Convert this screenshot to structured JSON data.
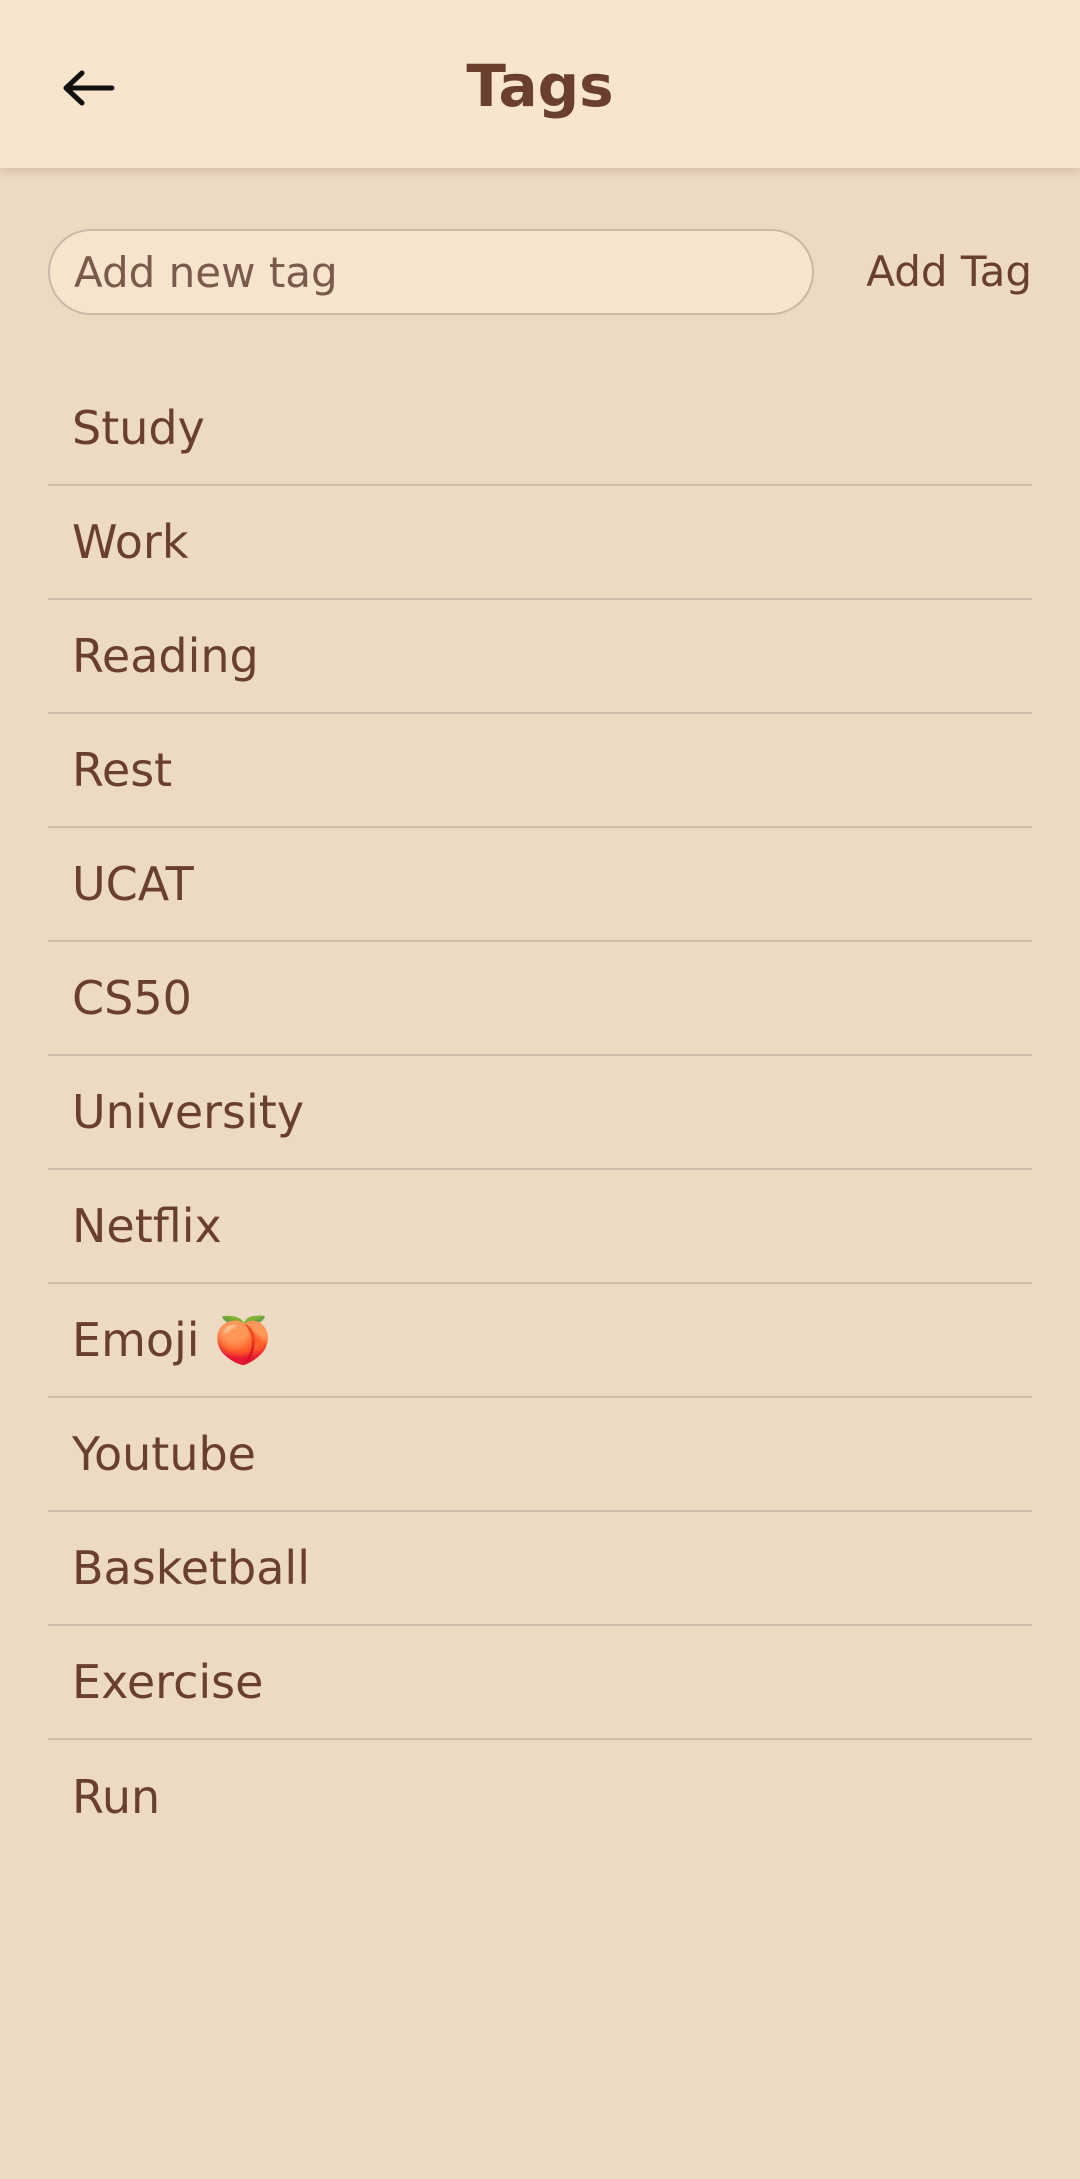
{
  "header": {
    "title": "Tags",
    "back_icon": "arrow-left-icon"
  },
  "add_tag": {
    "placeholder": "Add new tag",
    "value": "",
    "button_label": "Add Tag"
  },
  "tags": [
    "Study",
    "Work",
    "Reading",
    "Rest",
    "UCAT",
    "CS50",
    "University",
    "Netflix",
    "Emoji 🍑",
    "Youtube",
    "Basketball",
    "Exercise",
    "Run"
  ],
  "colors": {
    "background": "#eddac2",
    "app_bar": "#f7e5cf",
    "text": "#6b3f2e",
    "divider": "#cdbfae"
  }
}
